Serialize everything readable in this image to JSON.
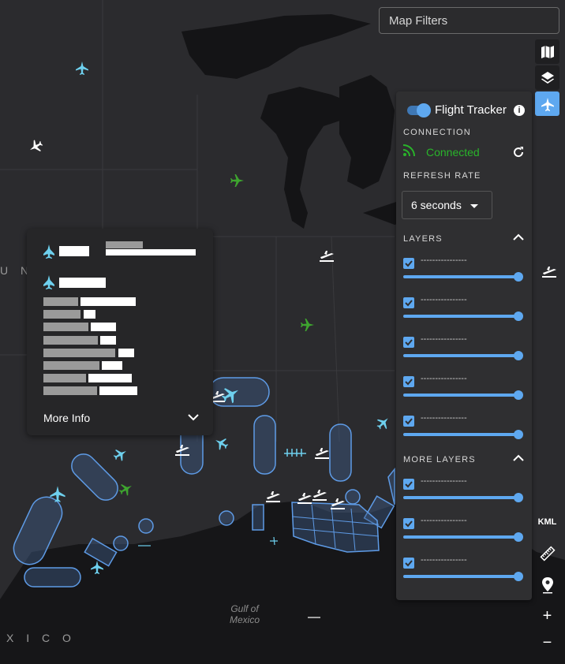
{
  "map": {
    "labels": {
      "gulf": "Gulf of\nMexico",
      "country_left": "U N",
      "country_bottom": "X I C O"
    }
  },
  "filters": {
    "label": "Map Filters"
  },
  "toolbar": {
    "buttons": [
      {
        "icon": "map-icon"
      },
      {
        "icon": "layers-icon"
      },
      {
        "icon": "airplane-icon",
        "active": true
      }
    ],
    "kml_label": "KML",
    "zoom_in": "+",
    "zoom_out": "−"
  },
  "panel": {
    "title": "Flight Tracker",
    "info": "i",
    "connection_label": "CONNECTION",
    "connection_status": "Connected",
    "refresh_label": "REFRESH RATE",
    "refresh_value": "6 seconds",
    "layers_label": "LAYERS",
    "layers": [
      {
        "name": "----------------",
        "opacity": 1
      },
      {
        "name": "----------------",
        "opacity": 1
      },
      {
        "name": "----------------",
        "opacity": 1
      },
      {
        "name": "----------------",
        "opacity": 1
      },
      {
        "name": "----------------",
        "opacity": 1
      }
    ],
    "more_layers_label": "MORE LAYERS",
    "more_layers": [
      {
        "name": "----------------",
        "opacity": 1
      },
      {
        "name": "----------------",
        "opacity": 1
      },
      {
        "name": "----------------",
        "opacity": 1
      }
    ],
    "colors": {
      "accent": "#5ea8f0",
      "connected": "#29b42a"
    }
  },
  "popup": {
    "more_info": "More Info"
  }
}
